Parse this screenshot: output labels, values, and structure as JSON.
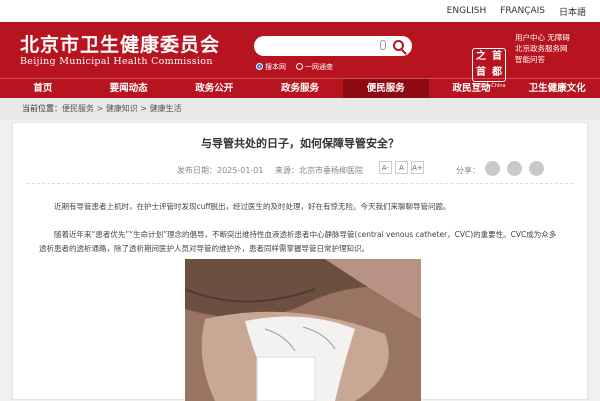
{
  "lang": [
    "ENGLISH",
    "FRANÇAIS",
    "日本語"
  ],
  "header": {
    "title_cn": "北京市卫生健康委员会",
    "title_en": "Beijing Municipal Health Commission",
    "search_options": [
      "搜本网",
      "一网通查"
    ],
    "seal_chars": [
      "之",
      "首",
      "首",
      "都"
    ],
    "seal_sub": "Beijing-China",
    "links": [
      "用户中心",
      "无障碍",
      "北京政务服务网",
      "智能问答"
    ]
  },
  "nav": [
    "首页",
    "要闻动态",
    "政务公开",
    "政务服务",
    "便民服务",
    "政民互动",
    "卫生健康文化"
  ],
  "nav_active": 4,
  "breadcrumb": {
    "lead": "当前位置：",
    "path": "便民服务 > 健康知识 > 健康生活"
  },
  "article": {
    "title": "与导管共处的日子，如何保障导管安全？",
    "date": "发布日期：2025-01-01",
    "source": "来源：北京市垂杨柳医院",
    "font_sizes": [
      "A-",
      "A",
      "A+"
    ],
    "share_label": "分享：",
    "para1": "近期有导管患者上机时，在护士评管时发现cuff脱出，经过医生的及时处理，好在有惊无险。今天我们来聊聊导管问题。",
    "para2": "随着近年来“患者优先”“生命计划”理念的倡导，不断突出维持性血液透析患者中心静脉导管(central venous catheter，CVC)的重要性。CVC成为众多透析患者的透析通路，除了透析期间医护人员对导管的维护外，患者同样需掌握导管日常护理知识。"
  },
  "icons": [
    "microphone-icon",
    "search-icon",
    "wechat-icon",
    "weibo-icon",
    "qq-icon"
  ],
  "colors": {
    "brand_red": "#b7141f",
    "nav_active": "#8e0a13",
    "background": "#f0f0f0"
  }
}
